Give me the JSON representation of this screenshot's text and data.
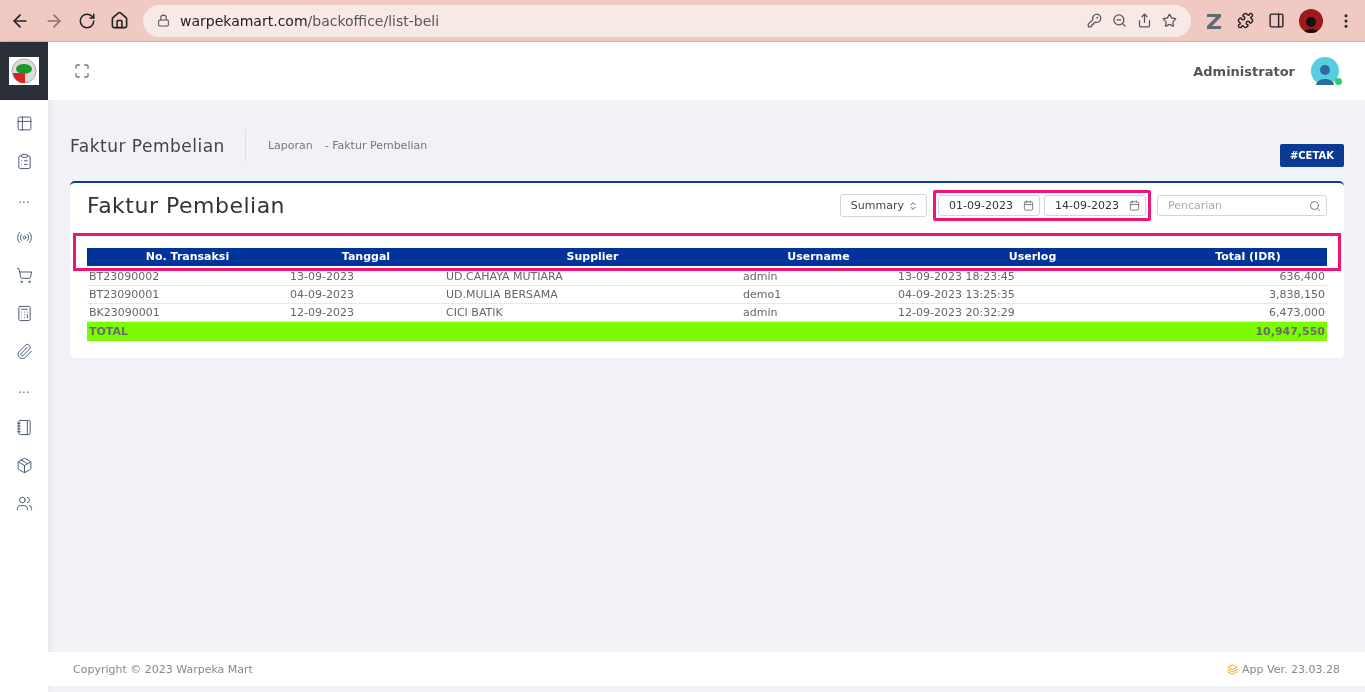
{
  "browser": {
    "url_host": "warpekamart.com",
    "url_path": "/backoffice/list-beli"
  },
  "sidebar": {
    "items": [
      {
        "kind": "icon"
      },
      {
        "kind": "icon"
      },
      {
        "kind": "dots",
        "label": "..."
      },
      {
        "kind": "icon"
      },
      {
        "kind": "icon"
      },
      {
        "kind": "icon"
      },
      {
        "kind": "icon"
      },
      {
        "kind": "dots",
        "label": "..."
      },
      {
        "kind": "icon"
      },
      {
        "kind": "icon"
      },
      {
        "kind": "icon"
      }
    ]
  },
  "header": {
    "user": "Administrator",
    "online": true
  },
  "page": {
    "title": "Faktur Pembelian",
    "breadcrumb": [
      "Laporan",
      "- Faktur Pembelian"
    ],
    "print_button": "#CETAK"
  },
  "card": {
    "title": "Faktur Pembelian",
    "mode": "Summary",
    "date_from": "01-09-2023",
    "date_to": "14-09-2023",
    "search_placeholder": "Pencarian",
    "table": {
      "columns": [
        "No. Transaksi",
        "Tanggal",
        "Supplier",
        "Username",
        "Userlog",
        "Total (IDR)"
      ],
      "rows": [
        [
          "BT23090002",
          "13-09-2023",
          "UD.CAHAYA MUTIARA",
          "admin",
          "13-09-2023 18:23:45",
          "636,400"
        ],
        [
          "BT23090001",
          "04-09-2023",
          "UD.MULIA BERSAMA",
          "demo1",
          "04-09-2023 13:25:35",
          "3,838,150"
        ],
        [
          "BK23090001",
          "12-09-2023",
          "CICI BATIK",
          "admin",
          "12-09-2023 20:32:29",
          "6,473,000"
        ]
      ],
      "total": {
        "label": "TOTAL",
        "value": "10,947,550"
      }
    }
  },
  "footer": {
    "copyright": "Copyright © 2023 Warpeka Mart",
    "version": "App Ver. 23.03.28"
  }
}
